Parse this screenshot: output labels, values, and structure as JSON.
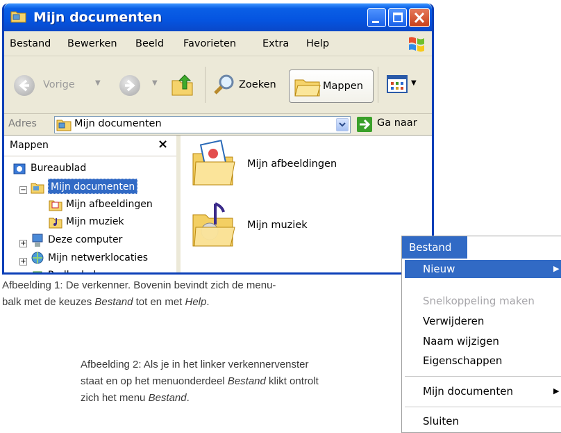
{
  "window": {
    "title": "Mijn documenten",
    "accent": "#0554e0"
  },
  "menubar": {
    "items": [
      "Bestand",
      "Bewerken",
      "Beeld",
      "Favorieten",
      "Extra",
      "Help"
    ]
  },
  "toolbar": {
    "back_label": "Vorige",
    "search_label": "Zoeken",
    "folders_label": "Mappen"
  },
  "address": {
    "label": "Adres",
    "value": "Mijn documenten",
    "go_label": "Ga naar"
  },
  "folders_pane": {
    "title": "Mappen",
    "close": "×",
    "tree": [
      "Bureaublad",
      "Mijn documenten",
      "Mijn afbeeldingen",
      "Mijn muziek",
      "Deze computer",
      "Mijn netwerklocaties",
      "Prullenbak"
    ]
  },
  "main": {
    "items": [
      "Mijn afbeeldingen",
      "Mijn muziek"
    ]
  },
  "captions": {
    "cap1_line1": "Afbeelding 1: De verkenner. Bovenin bevindt zich de menu-",
    "cap1_line2_pre": "balk met de keuzes ",
    "cap1_em1": "Bestand",
    "cap1_mid": " tot en met ",
    "cap1_em2": "Help",
    "cap1_end": ".",
    "cap2_line1": "Afbeelding 2: Als je in het linker verkennervenster",
    "cap2_line2_pre": "staat en op het menuonderdeel ",
    "cap2_em1": "Bestand",
    "cap2_line2_post": " klikt ontrolt",
    "cap2_line3_pre": "zich het menu ",
    "cap2_em2": "Bestand",
    "cap2_line3_post": "."
  },
  "context_menu": {
    "header": "Bestand",
    "items": [
      "Nieuw",
      "Snelkoppeling maken",
      "Verwijderen",
      "Naam wijzigen",
      "Eigenschappen",
      "Mijn documenten",
      "Sluiten"
    ]
  }
}
